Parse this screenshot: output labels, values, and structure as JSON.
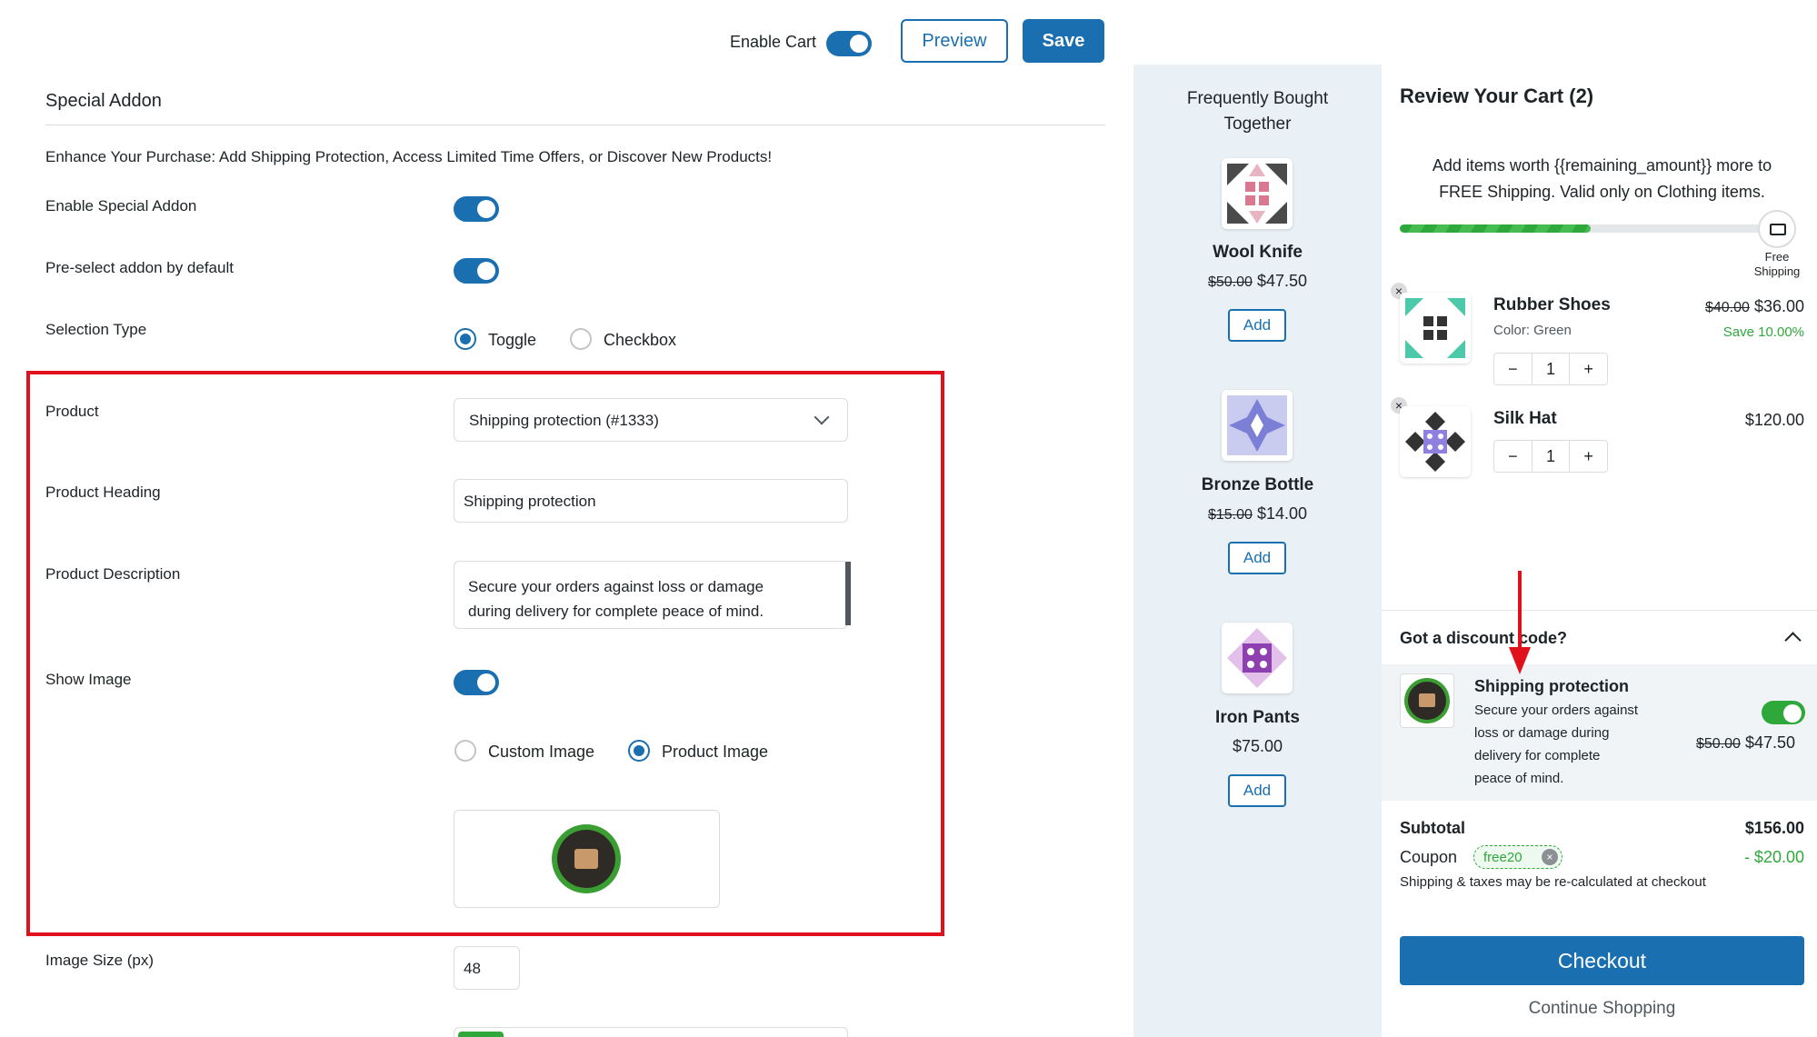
{
  "header": {
    "enable_cart_label": "Enable Cart",
    "preview_label": "Preview",
    "save_label": "Save"
  },
  "settings": {
    "section_title": "Special Addon",
    "intro": "Enhance Your Purchase: Add Shipping Protection, Access Limited Time Offers, or Discover New Products!",
    "enable_special_addon": "Enable Special Addon",
    "preselect": "Pre-select addon by default",
    "selection_type": "Selection Type",
    "selection_options": [
      "Toggle",
      "Checkbox"
    ],
    "product": "Product",
    "product_value": "Shipping protection (#1333)",
    "product_heading": "Product Heading",
    "product_heading_value": "Shipping protection",
    "product_description": "Product Description",
    "product_description_value_line1": "Secure your orders against loss or damage",
    "product_description_value_line2": "during delivery for complete peace of mind.",
    "show_image": "Show Image",
    "image_options": [
      "Custom Image",
      "Product Image"
    ],
    "image_size": "Image Size (px)",
    "image_size_value": "48"
  },
  "fbt": {
    "title_line1": "Frequently Bought",
    "title_line2": "Together",
    "add_label": "Add",
    "products": [
      {
        "name": "Wool Knife",
        "old_price": "$50.00",
        "price": "$47.50"
      },
      {
        "name": "Bronze Bottle",
        "old_price": "$15.00",
        "price": "$14.00"
      },
      {
        "name": "Iron Pants",
        "old_price": "",
        "price": "$75.00"
      }
    ]
  },
  "cart": {
    "title": "Review Your Cart (2)",
    "shipping_msg_line1": "Add items worth {{remaining_amount}} more to",
    "shipping_msg_line2": "FREE Shipping. Valid only on Clothing items.",
    "progress_fraction": 0.5,
    "free_shipping_line1": "Free",
    "free_shipping_line2": "Shipping",
    "items": [
      {
        "name": "Rubber Shoes",
        "meta": "Color: Green",
        "old_price": "$40.00",
        "price": "$36.00",
        "save": "Save 10.00%",
        "qty": "1"
      },
      {
        "name": "Silk Hat",
        "meta": "",
        "old_price": "",
        "price": "$120.00",
        "save": "",
        "qty": "1"
      }
    ],
    "qty_minus": "−",
    "qty_plus": "+",
    "remove_glyph": "×",
    "discount_label": "Got a discount code?",
    "addon": {
      "name": "Shipping protection",
      "desc_line1": "Secure your orders against",
      "desc_line2": "loss or damage during",
      "desc_line3": "delivery for complete",
      "desc_line4": "peace of mind.",
      "old_price": "$50.00",
      "price": "$47.50"
    },
    "subtotal_label": "Subtotal",
    "subtotal_value": "$156.00",
    "coupon_label": "Coupon",
    "coupon_code": "free20",
    "coupon_value": "-  $20.00",
    "shipping_note": "Shipping & taxes may be re-calculated at checkout",
    "checkout_label": "Checkout",
    "continue_label": "Continue Shopping"
  },
  "colors": {
    "accent": "#1a6fb0",
    "success": "#2ea83b",
    "highlight": "#e0111b",
    "panel_bg": "#e9f1f6"
  }
}
